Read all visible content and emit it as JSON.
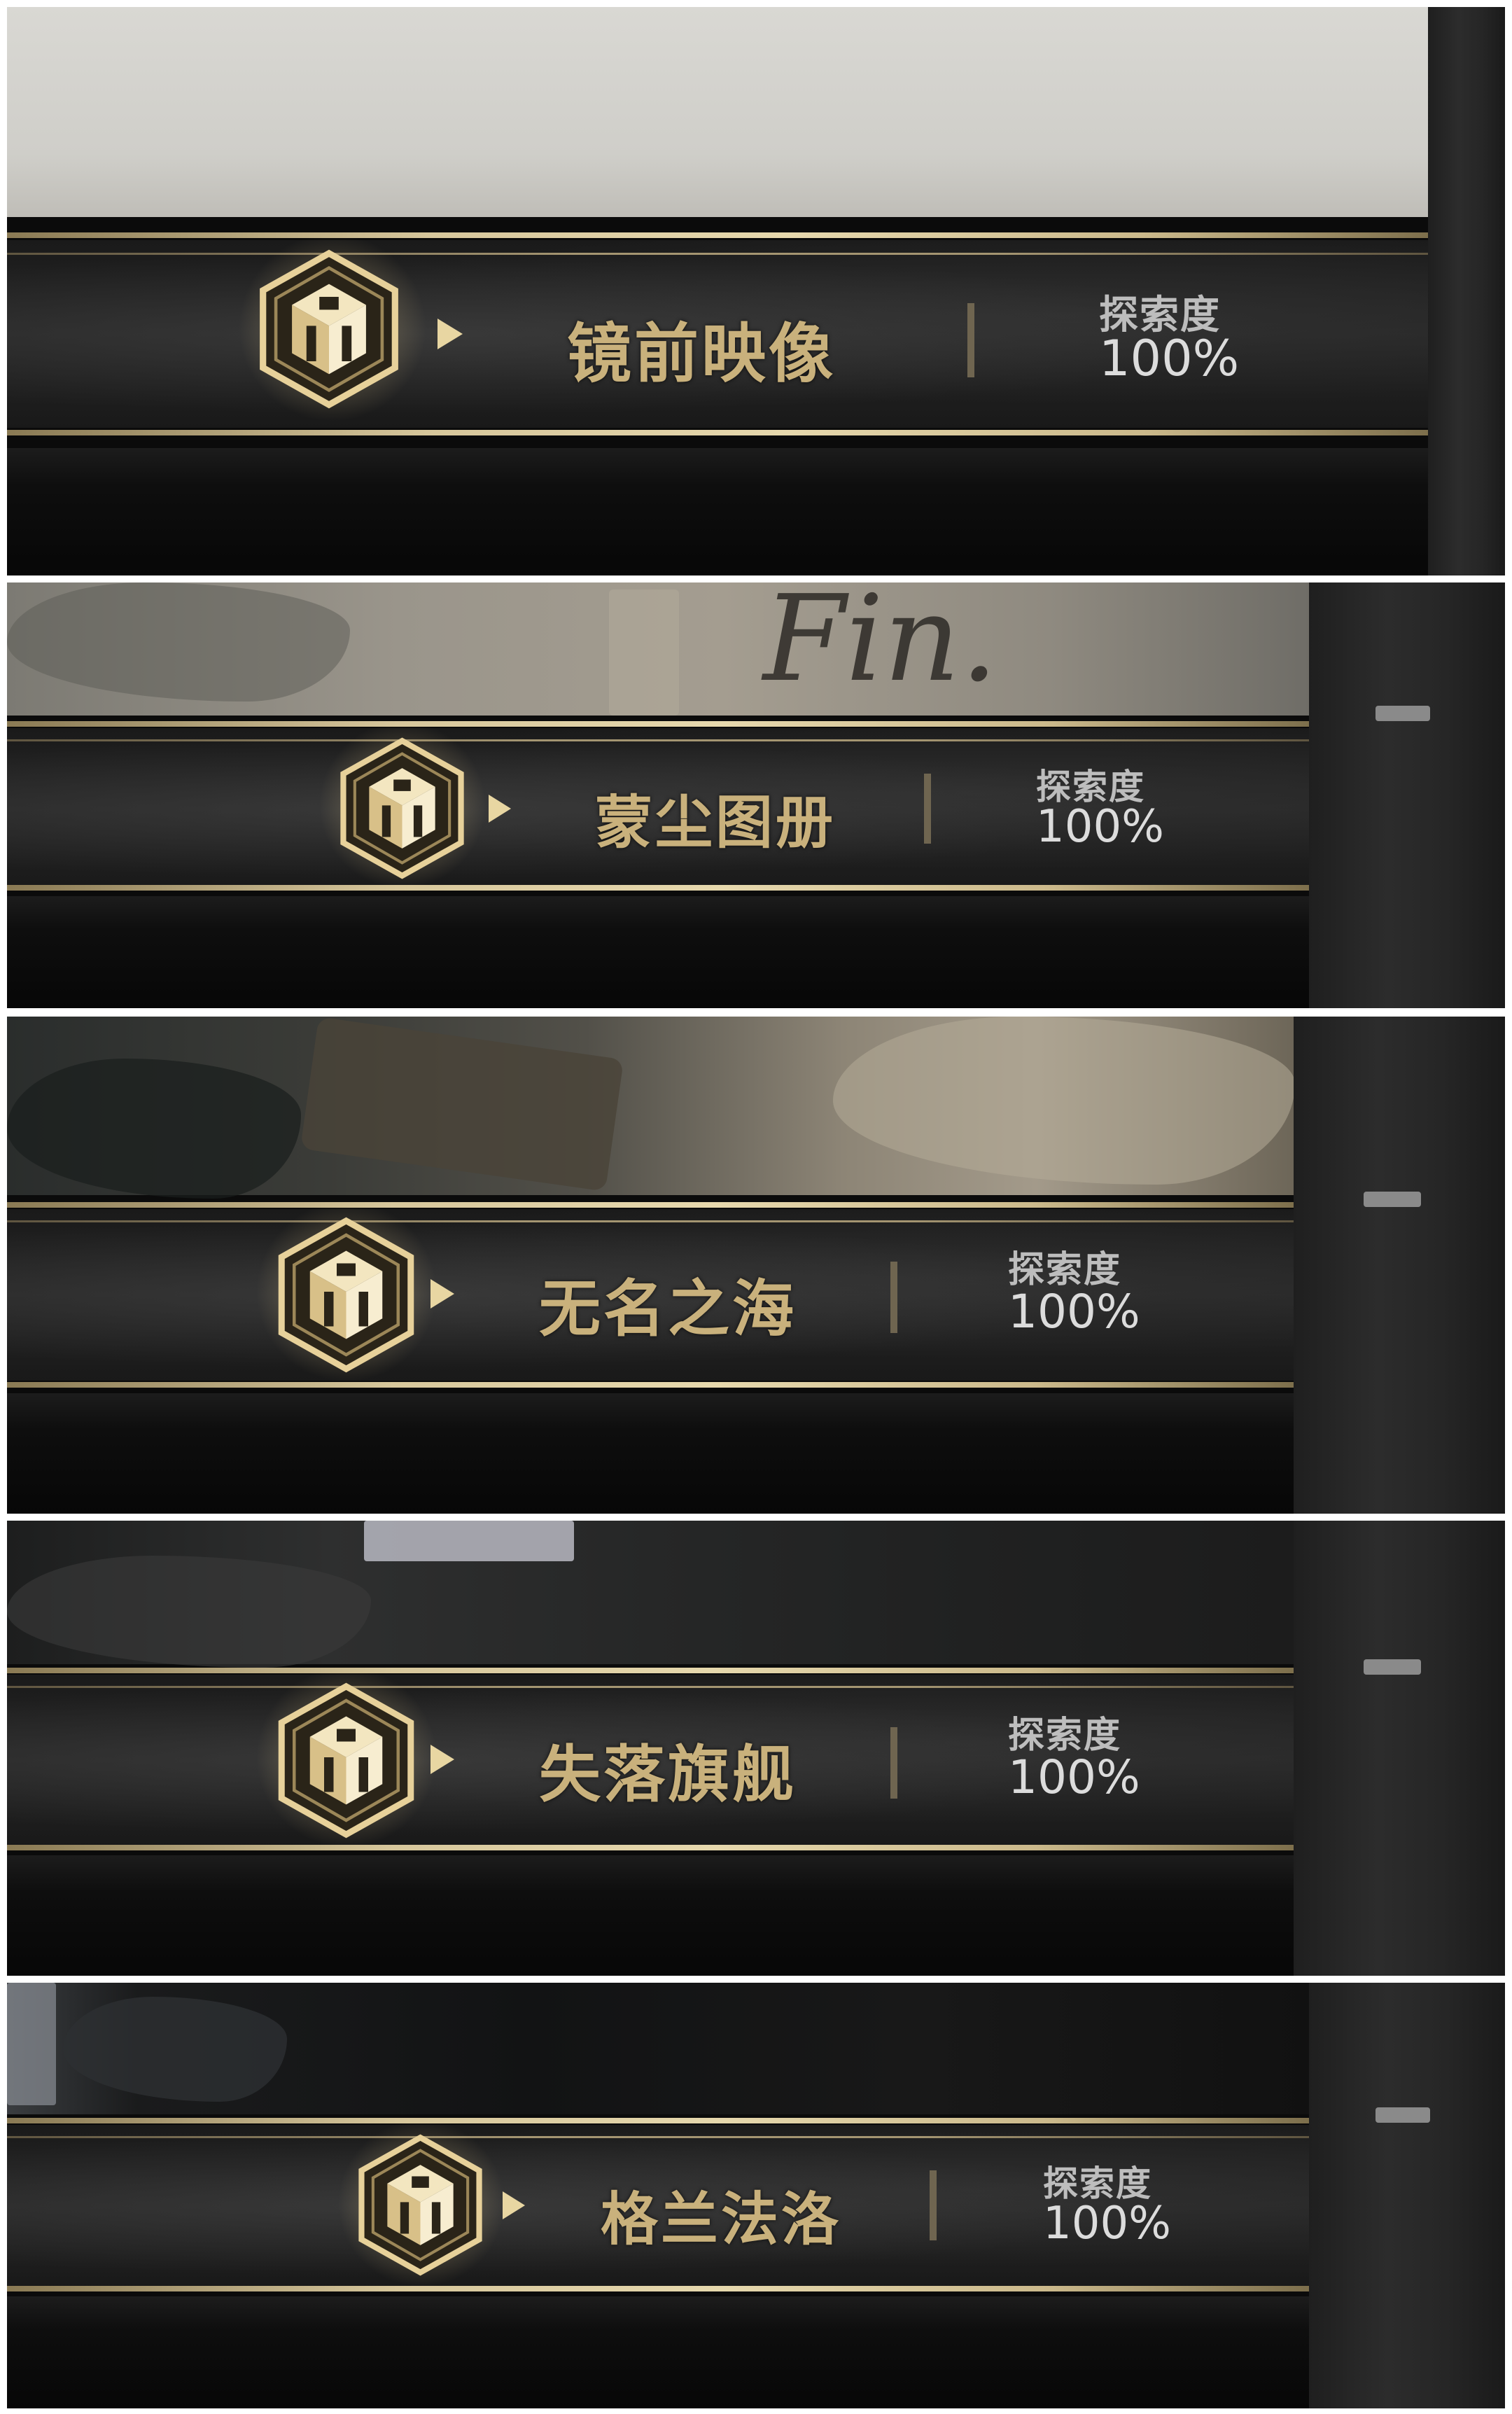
{
  "colors": {
    "gold_text": "#c9b17c",
    "gold_line": "#d7c79c",
    "play_arrow": "#e8d6a2",
    "label_gray": "#bdbdbd",
    "value_white": "#dcdcdc",
    "banner_dark": "#1f1f1f"
  },
  "regions": [
    {
      "name": "镜前映像",
      "explore_label": "探索度",
      "explore_value": "100%",
      "icon": "cube-hexagon-icon",
      "arrow": "play-arrow-icon"
    },
    {
      "name": "蒙尘图册",
      "explore_label": "探索度",
      "explore_value": "100%",
      "icon": "cube-hexagon-icon",
      "arrow": "play-arrow-icon",
      "background_script": "Fin."
    },
    {
      "name": "无名之海",
      "explore_label": "探索度",
      "explore_value": "100%",
      "icon": "cube-hexagon-icon",
      "arrow": "play-arrow-icon"
    },
    {
      "name": "失落旗舰",
      "explore_label": "探索度",
      "explore_value": "100%",
      "icon": "cube-hexagon-icon",
      "arrow": "play-arrow-icon"
    },
    {
      "name": "格兰法洛",
      "explore_label": "探索度",
      "explore_value": "100%",
      "icon": "cube-hexagon-icon",
      "arrow": "play-arrow-icon"
    }
  ]
}
